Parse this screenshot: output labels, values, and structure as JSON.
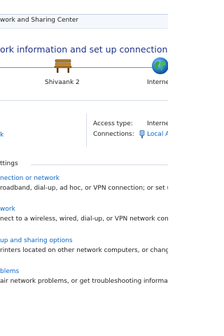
{
  "window": {
    "breadcrumb": "work and Sharing Center"
  },
  "main": {
    "title": "ork information and set up connections"
  },
  "network_map": {
    "computer_label": "Shivaank  2",
    "internet_label": "Interne"
  },
  "active_network": {
    "network_link": "k",
    "access_type_label": "Access type:",
    "access_type_value": "Interne",
    "connections_label": "Connections:",
    "connections_value": "Local A"
  },
  "settings": {
    "header": "ttings",
    "tasks": [
      {
        "link": "nection or network",
        "description": "roadband, dial-up, ad hoc, or VPN connection; or set up"
      },
      {
        "link": "work",
        "description": "nect to a wireless, wired, dial-up, or VPN network conne"
      },
      {
        "link": "up and sharing options",
        "description": "rinters located on other network computers, or change s"
      },
      {
        "link": "blems",
        "description": "air network problems, or get troubleshooting information"
      }
    ]
  },
  "colors": {
    "link": "#0c66c4",
    "title": "#1e3287",
    "text": "#1e1e1e"
  }
}
